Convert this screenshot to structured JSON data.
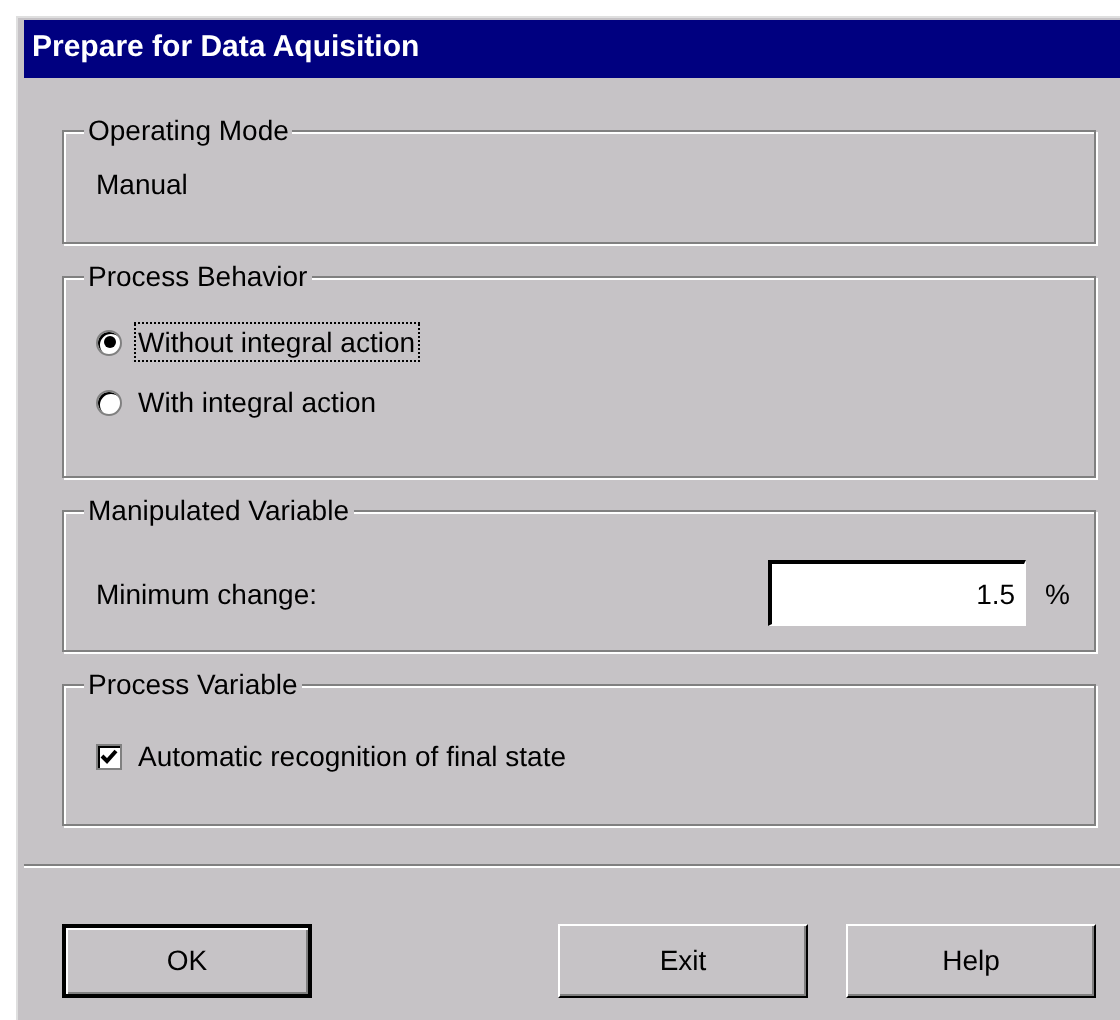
{
  "window": {
    "title": "Prepare for Data Aquisition"
  },
  "operating_mode": {
    "label": "Operating Mode",
    "value": "Manual"
  },
  "process_behavior": {
    "label": "Process Behavior",
    "options": [
      {
        "label": "Without integral action",
        "selected": true,
        "focused": true
      },
      {
        "label": "With integral action",
        "selected": false,
        "focused": false
      }
    ]
  },
  "manipulated_variable": {
    "label": "Manipulated Variable",
    "field_label": "Minimum change:",
    "value": "1.5",
    "unit": "%"
  },
  "process_variable": {
    "label": "Process Variable",
    "checkbox": {
      "label": "Automatic recognition of final state",
      "checked": true
    }
  },
  "buttons": [
    {
      "label": "OK",
      "default": true
    },
    {
      "label": "Exit",
      "default": false
    },
    {
      "label": "Help",
      "default": false
    }
  ]
}
